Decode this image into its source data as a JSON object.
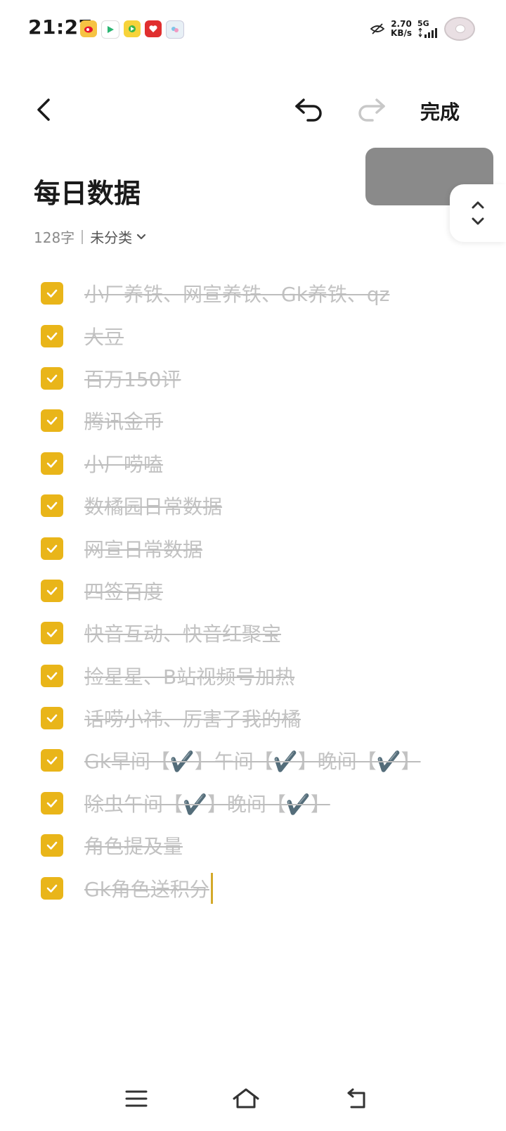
{
  "status": {
    "time": "21:27",
    "net_speed_value": "2.70",
    "net_speed_unit": "KB/s",
    "network_type": "5G",
    "app_icons": [
      "weibo-icon",
      "play-icon",
      "music-icon",
      "heart-app-icon",
      "bubble-app-icon"
    ]
  },
  "toolbar": {
    "done_label": "完成"
  },
  "note": {
    "title": "每日数据",
    "char_count": "128字",
    "category": "未分类"
  },
  "todos": [
    {
      "text": "小厂养铁、网宣养铁、Gk养铁、qz",
      "checked": true
    },
    {
      "text": "大豆",
      "checked": true
    },
    {
      "text": "百万150评",
      "checked": true
    },
    {
      "text": "腾讯金币",
      "checked": true
    },
    {
      "text": "小厂唠嗑",
      "checked": true
    },
    {
      "text": "数橘园日常数据",
      "checked": true
    },
    {
      "text": "网宣日常数据",
      "checked": true
    },
    {
      "text": "四签百度",
      "checked": true
    },
    {
      "text": "快音互动、快音红聚宝",
      "checked": true
    },
    {
      "text": "捡星星、B站视频号加热",
      "checked": true
    },
    {
      "text": "话唠小祎、厉害了我的橘",
      "checked": true
    },
    {
      "text": "Gk早间【✔️】午间【✔️】晚间【✔️】",
      "checked": true
    },
    {
      "text": "除虫午间【✔️】晚间【✔️】",
      "checked": true
    },
    {
      "text": "角色提及量",
      "checked": true
    },
    {
      "text": "Gk角色送积分",
      "checked": true
    }
  ],
  "colors": {
    "accent": "#e9b519",
    "done_text": "#c2c2c2"
  }
}
